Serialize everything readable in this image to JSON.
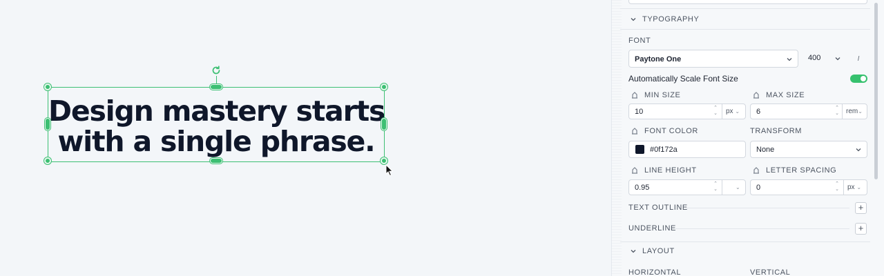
{
  "canvas": {
    "headline_line1": "Design mastery starts",
    "headline_line2": "with a single phrase.",
    "selection_color": "#3cbf73",
    "text_color": "#0f172a"
  },
  "panel": {
    "typography": {
      "title": "TYPOGRAPHY",
      "font_label": "FONT",
      "font_value": "Paytone One",
      "weight_value": "400",
      "italic_label": "I",
      "auto_scale_label": "Automatically Scale Font Size",
      "auto_scale_on": true,
      "min_size_label": "MIN SIZE",
      "min_size_value": "10",
      "min_size_unit": "px",
      "max_size_label": "MAX SIZE",
      "max_size_value": "6",
      "max_size_unit": "rem",
      "font_color_label": "FONT COLOR",
      "font_color_value": "#0f172a",
      "transform_label": "TRANSFORM",
      "transform_value": "None",
      "line_height_label": "LINE HEIGHT",
      "line_height_value": "0.95",
      "letter_spacing_label": "LETTER SPACING",
      "letter_spacing_value": "0",
      "letter_spacing_unit": "px",
      "text_outline_label": "TEXT OUTLINE",
      "underline_label": "UNDERLINE",
      "add_symbol": "+"
    },
    "layout": {
      "title": "LAYOUT",
      "horizontal_label": "HORIZONTAL",
      "vertical_label": "VERTICAL"
    },
    "icons": {
      "collapse": "chevron-down-icon",
      "device": "breakpoint-icon",
      "rotate": "rotate-icon",
      "cursor": "cursor-icon"
    },
    "accent_color": "#36c16e"
  }
}
